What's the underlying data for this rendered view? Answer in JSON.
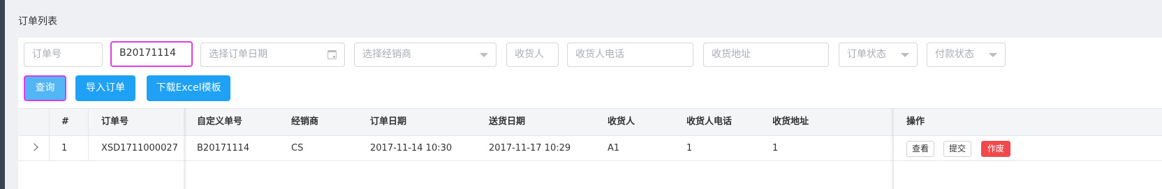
{
  "page": {
    "title": "订单列表"
  },
  "filters": {
    "order_no_placeholder": "订单号",
    "custom_no_value": "B20171114",
    "order_date_placeholder": "选择订单日期",
    "dealer_placeholder": "选择经销商",
    "receiver_placeholder": "收货人",
    "receiver_phone_placeholder": "收货人电话",
    "receiver_address_placeholder": "收货地址",
    "order_status_placeholder": "订单状态",
    "payment_status_placeholder": "付款状态"
  },
  "actions": {
    "query": "查询",
    "import": "导入订单",
    "download": "下载Excel模板"
  },
  "table": {
    "columns": {
      "index": "#",
      "order_no": "订单号",
      "custom_no": "自定义单号",
      "dealer": "经销商",
      "order_date": "订单日期",
      "delivery_date": "送货日期",
      "receiver": "收货人",
      "receiver_phone": "收货人电话",
      "receiver_address": "收货地址",
      "operations": "操作"
    },
    "rows": [
      {
        "index": "1",
        "order_no": "XSD1711000027",
        "custom_no": "B20171114",
        "dealer": "CS",
        "order_date": "2017-11-14 10:30",
        "delivery_date": "2017-11-17 10:29",
        "receiver": "A1",
        "receiver_phone": "1",
        "receiver_address": "1",
        "view": "查看",
        "submit": "提交",
        "void": "作废"
      }
    ]
  },
  "colors": {
    "primary": "#1fa1f6",
    "danger": "#f0484b",
    "highlight": "#e13be7"
  }
}
